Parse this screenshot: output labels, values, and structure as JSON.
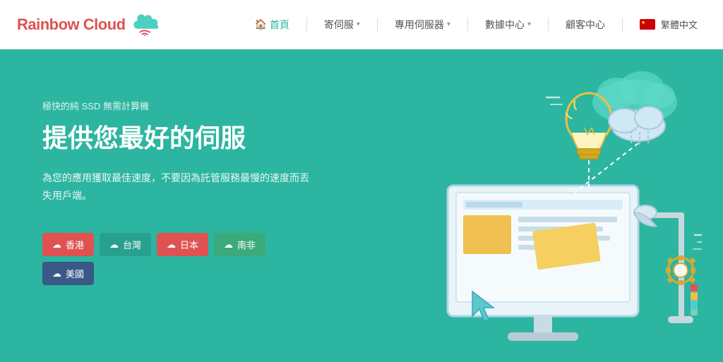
{
  "header": {
    "logo_text_rainbow": "Rainbow",
    "logo_text_cloud": "Cloud",
    "nav": [
      {
        "label": "首頁",
        "icon": "home",
        "active": true,
        "has_dropdown": false
      },
      {
        "label": "寄伺服",
        "active": false,
        "has_dropdown": true
      },
      {
        "label": "專用伺服器",
        "active": false,
        "has_dropdown": true
      },
      {
        "label": "數據中心",
        "active": false,
        "has_dropdown": true
      },
      {
        "label": "顧客中心",
        "active": false,
        "has_dropdown": false
      }
    ],
    "lang": "繁體中文"
  },
  "hero": {
    "subtitle": "極快的純 SSD 無需計算機",
    "title": "提供您最好的伺服",
    "desc": "為您的應用獲取最佳速度，不要因為託管服務最慢的速度而丟失用戶端。",
    "badges": [
      {
        "label": "香港",
        "color": "red",
        "icon": "☁"
      },
      {
        "label": "台灣",
        "color": "teal",
        "icon": "☁"
      },
      {
        "label": "日本",
        "color": "red",
        "icon": "☁"
      },
      {
        "label": "南非",
        "color": "green",
        "icon": "☁"
      },
      {
        "label": "美國",
        "color": "navy",
        "icon": "☁"
      }
    ]
  }
}
